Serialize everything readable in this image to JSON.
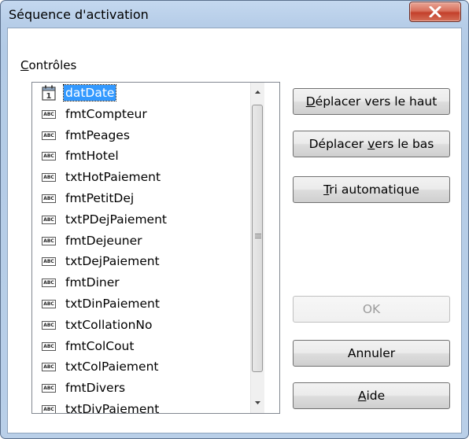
{
  "window": {
    "title": "Séquence d'activation"
  },
  "controls_group": {
    "label": "Contrôles"
  },
  "list": {
    "items": [
      {
        "label": "datDate",
        "icon": "calendar-icon",
        "selected": true
      },
      {
        "label": "fmtCompteur",
        "icon": "text-field-icon"
      },
      {
        "label": "fmtPeages",
        "icon": "text-field-icon"
      },
      {
        "label": "fmtHotel",
        "icon": "text-field-icon"
      },
      {
        "label": "txtHotPaiement",
        "icon": "text-field-icon"
      },
      {
        "label": "fmtPetitDej",
        "icon": "text-field-icon"
      },
      {
        "label": "txtPDejPaiement",
        "icon": "text-field-icon"
      },
      {
        "label": "fmtDejeuner",
        "icon": "text-field-icon"
      },
      {
        "label": "txtDejPaiement",
        "icon": "text-field-icon"
      },
      {
        "label": "fmtDiner",
        "icon": "text-field-icon"
      },
      {
        "label": "txtDinPaiement",
        "icon": "text-field-icon"
      },
      {
        "label": "txtCollationNo",
        "icon": "text-field-icon"
      },
      {
        "label": "fmtColCout",
        "icon": "text-field-icon"
      },
      {
        "label": "txtColPaiement",
        "icon": "text-field-icon"
      },
      {
        "label": "fmtDivers",
        "icon": "text-field-icon"
      },
      {
        "label": "txtDivPaiement",
        "icon": "text-field-icon"
      }
    ],
    "icon_text": "ABC"
  },
  "buttons": {
    "move_up": "Déplacer vers le haut",
    "move_down": "Déplacer vers le bas",
    "auto_sort": "Tri automatique",
    "ok": "OK",
    "cancel": "Annuler",
    "help": "Aide"
  },
  "colors": {
    "selection": "#3399ff",
    "close_button": "#c3412c"
  }
}
